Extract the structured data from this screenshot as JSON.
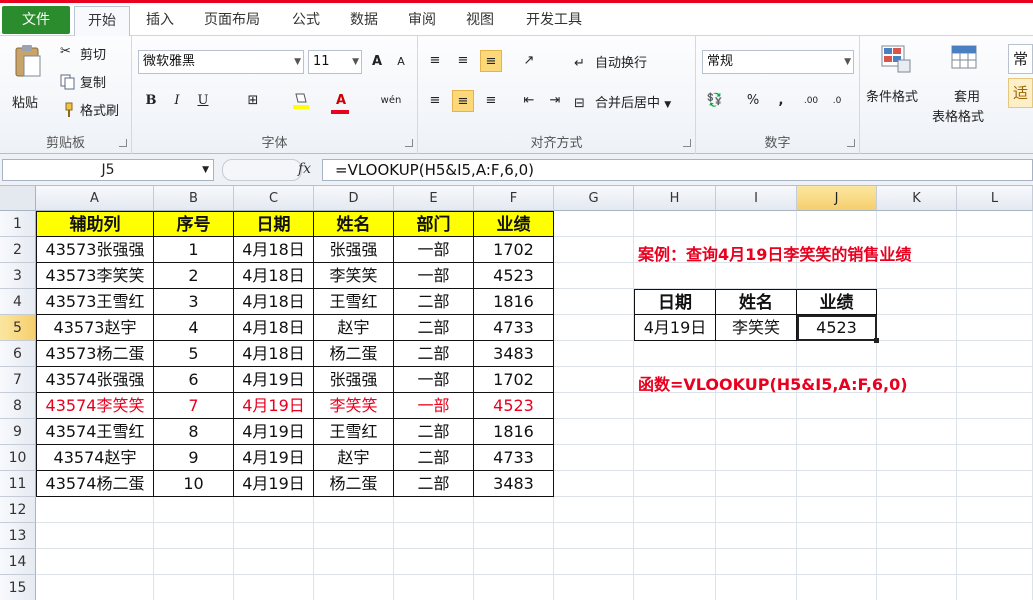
{
  "tabs": {
    "file": "文件",
    "items": [
      "开始",
      "插入",
      "页面布局",
      "公式",
      "数据",
      "审阅",
      "视图",
      "开发工具"
    ]
  },
  "clipboard": {
    "paste": "粘贴",
    "cut": "剪切",
    "copy": "复制",
    "format_painter": "格式刷",
    "label": "剪贴板"
  },
  "font": {
    "name": "微软雅黑",
    "size": "11",
    "grow": "A",
    "shrink": "A",
    "bold": "B",
    "italic": "I",
    "underline": "U",
    "color_a": "A",
    "phonetic": "wén",
    "label": "字体"
  },
  "alignment": {
    "wrap": "自动换行",
    "merge": "合并后居中",
    "label": "对齐方式"
  },
  "number": {
    "format": "常规",
    "percent": "%",
    "comma": ",",
    "inc": ".00",
    "dec": ".0",
    "label": "数字"
  },
  "styles": {
    "cond": "条件格式",
    "table_l1": "套用",
    "table_l2": "表格格式",
    "cell_l1": "常",
    "cell_l2": "适"
  },
  "formula_bar": {
    "name_box": "J5",
    "fx": "fx",
    "formula": "=VLOOKUP(H5&I5,A:F,6,0)"
  },
  "sheet": {
    "columns": [
      "A",
      "B",
      "C",
      "D",
      "E",
      "F",
      "G",
      "H",
      "I",
      "J",
      "K",
      "L"
    ],
    "rows": [
      "1",
      "2",
      "3",
      "4",
      "5",
      "6",
      "7",
      "8",
      "9",
      "10",
      "11",
      "12",
      "13",
      "14",
      "15"
    ],
    "headers": [
      "辅助列",
      "序号",
      "日期",
      "姓名",
      "部门",
      "业绩"
    ],
    "data": [
      [
        "43573张强强",
        "1",
        "4月18日",
        "张强强",
        "一部",
        "1702"
      ],
      [
        "43573李笑笑",
        "2",
        "4月18日",
        "李笑笑",
        "一部",
        "4523"
      ],
      [
        "43573王雪红",
        "3",
        "4月18日",
        "王雪红",
        "二部",
        "1816"
      ],
      [
        "43573赵宇",
        "4",
        "4月18日",
        "赵宇",
        "二部",
        "4733"
      ],
      [
        "43573杨二蛋",
        "5",
        "4月18日",
        "杨二蛋",
        "二部",
        "3483"
      ],
      [
        "43574张强强",
        "6",
        "4月19日",
        "张强强",
        "一部",
        "1702"
      ],
      [
        "43574李笑笑",
        "7",
        "4月19日",
        "李笑笑",
        "一部",
        "4523"
      ],
      [
        "43574王雪红",
        "8",
        "4月19日",
        "王雪红",
        "二部",
        "1816"
      ],
      [
        "43574赵宇",
        "9",
        "4月19日",
        "赵宇",
        "二部",
        "4733"
      ],
      [
        "43574杨二蛋",
        "10",
        "4月19日",
        "杨二蛋",
        "二部",
        "3483"
      ]
    ],
    "highlight_color": "#e8001e",
    "header_fill": "#ffff00"
  },
  "lookup": {
    "case_note": "案例：查询4月19日李笑笑的销售业绩",
    "headers": [
      "日期",
      "姓名",
      "业绩"
    ],
    "values": [
      "4月19日",
      "李笑笑",
      "4523"
    ],
    "function_note": "函数=VLOOKUP(H5&I5,A:F,6,0)"
  }
}
